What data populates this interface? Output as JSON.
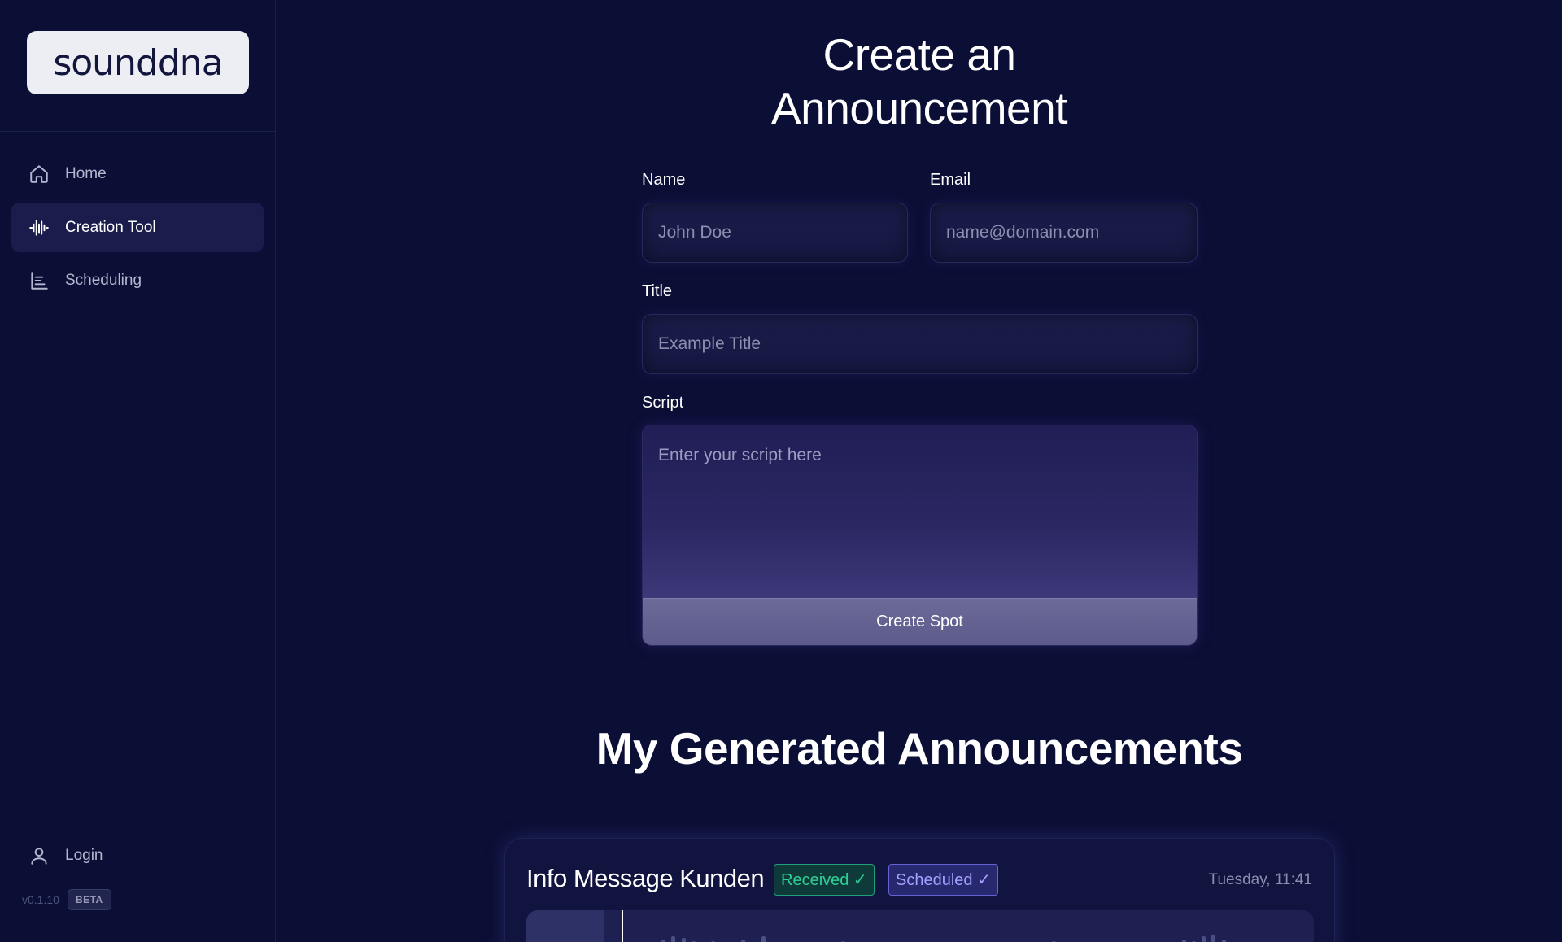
{
  "sidebar": {
    "logo_text": "sounddna",
    "nav": [
      {
        "label": "Home",
        "icon": "home-icon",
        "active": false
      },
      {
        "label": "Creation Tool",
        "icon": "waveform-icon",
        "active": true
      },
      {
        "label": "Scheduling",
        "icon": "list-chart-icon",
        "active": false
      }
    ],
    "login_label": "Login",
    "version": "v0.1.10",
    "beta": "BETA"
  },
  "form": {
    "title_line1": "Create an",
    "title_line2": "Announcement",
    "name_label": "Name",
    "name_placeholder": "John Doe",
    "email_label": "Email",
    "email_placeholder": "name@domain.com",
    "title_label": "Title",
    "title_placeholder": "Example Title",
    "script_label": "Script",
    "script_placeholder": "Enter your script here",
    "submit_label": "Create Spot"
  },
  "announcements": {
    "heading": "My Generated Announcements",
    "items": [
      {
        "title": "Info Message Kunden",
        "status_received": "Received ✓",
        "status_scheduled": "Scheduled ✓",
        "time": "Tuesday, 11:41"
      }
    ]
  },
  "colors": {
    "background": "#0b0e35",
    "received": "#2fcf95",
    "scheduled": "#a3a1ff"
  }
}
